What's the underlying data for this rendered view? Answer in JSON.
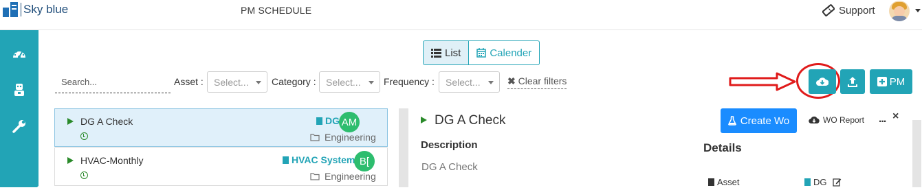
{
  "app": {
    "name": "Sky blue",
    "page_title": "PM SCHEDULE"
  },
  "header": {
    "support_label": "Support"
  },
  "view_toggle": {
    "list_label": "List",
    "calendar_label": "Calender"
  },
  "filters": {
    "search_placeholder": "Search...",
    "asset_label": "Asset :",
    "asset_placeholder": "Select...",
    "category_label": "Category :",
    "category_placeholder": "Select...",
    "frequency_label": "Frequency :",
    "frequency_placeholder": "Select...",
    "clear_label": "Clear filters"
  },
  "actions": {
    "pm_label": "PM"
  },
  "pm_list": [
    {
      "title": "DG A Check",
      "asset": "DG",
      "assignee": "AM",
      "category": "Engineering",
      "selected": true
    },
    {
      "title": "HVAC-Monthly",
      "asset": "HVAC System",
      "assignee": "B[",
      "category": "Engineering",
      "selected": false
    }
  ],
  "detail": {
    "title": "DG A Check",
    "create_wo_label": "Create Wo",
    "wo_report_label": "WO Report",
    "more_label": "...",
    "close_label": "×",
    "description_label": "Description",
    "description_text": "DG A Check",
    "details_label": "Details",
    "asset_field_label": "Asset",
    "asset_field_value": "DG"
  },
  "colors": {
    "accent": "#22a4b6",
    "primary_blue": "#1a8cff",
    "success_green": "#2dbd6e",
    "annotation_red": "#e01b1b"
  }
}
